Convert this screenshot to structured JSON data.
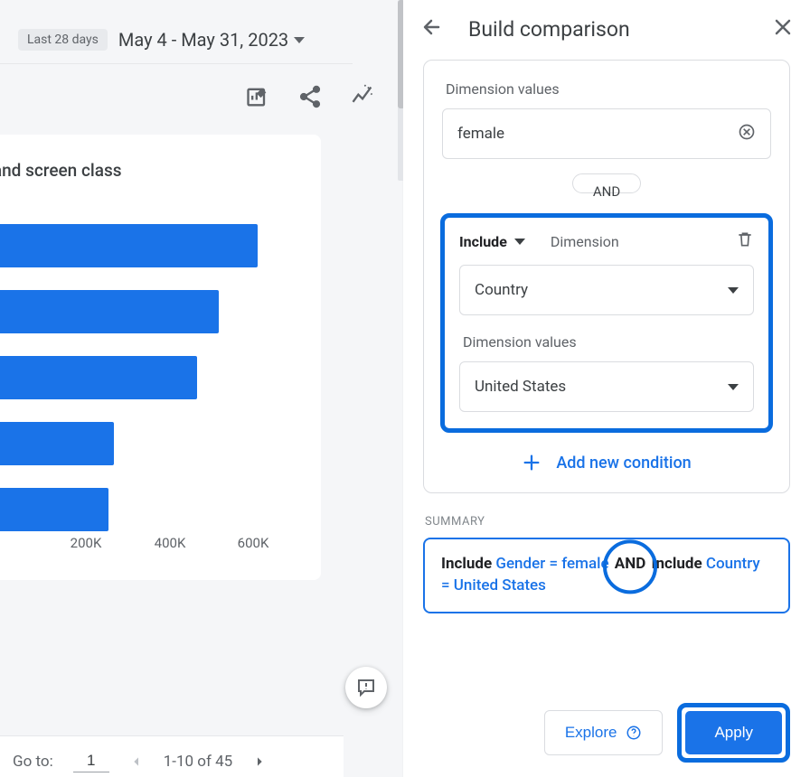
{
  "header": {
    "range_label": "Last 28 days",
    "date_range": "May 4 - May 31, 2023"
  },
  "chart_card": {
    "title_fragment": "ath and screen class"
  },
  "chart_data": {
    "type": "bar",
    "orientation": "horizontal",
    "title": "By page path and screen class",
    "xlabel": "",
    "ylabel": "",
    "x_ticks": [
      "200K",
      "400K",
      "600K"
    ],
    "x_tick_values": [
      200000,
      400000,
      600000
    ],
    "xlim": [
      0,
      700000
    ],
    "values": [
      675000,
      580000,
      525000,
      300000,
      275000
    ],
    "categories": [
      "",
      "",
      "",
      "",
      ""
    ]
  },
  "pagination": {
    "goto_label": "Go to:",
    "page": "1",
    "range_text": "1-10 of 45"
  },
  "panel": {
    "title": "Build comparison",
    "dim_values_label": "Dimension values",
    "first_value": "female",
    "and_label": "AND",
    "condition": {
      "include_label": "Include",
      "dimension_label": "Dimension",
      "dimension_value": "Country",
      "dim_values_label": "Dimension values",
      "value": "United States"
    },
    "add_condition_label": "Add new condition",
    "summary_label": "SUMMARY",
    "summary": {
      "include1": "Include",
      "cond1": "Gender = female",
      "and": "AND",
      "include2": "Include",
      "cond2": "Country = United States"
    },
    "explore_label": "Explore",
    "apply_label": "Apply"
  }
}
